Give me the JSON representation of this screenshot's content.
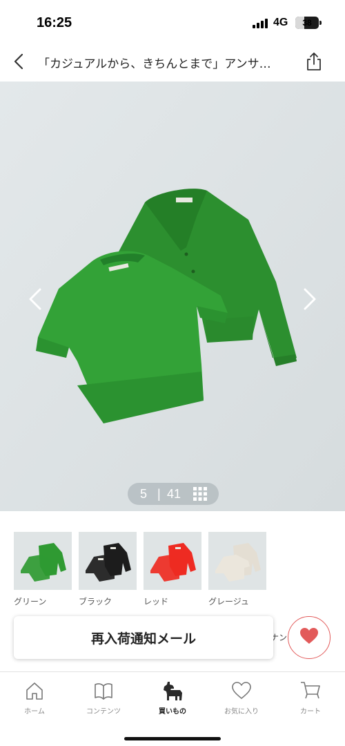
{
  "status_bar": {
    "time": "16:25",
    "network": "4G",
    "battery": "38",
    "battery_level": 0.38
  },
  "header": {
    "title": "「カジュアルから、きちんとまで」アンサ…",
    "back_icon": "chevron-left-icon",
    "share_icon": "share-icon"
  },
  "gallery": {
    "current": "5",
    "separator": "|",
    "total": "41",
    "background": "#dde3e5",
    "product_color": "#2f9a32"
  },
  "swatches": [
    {
      "label": "グリーン",
      "color": "#2f9a32"
    },
    {
      "label": "ブラック",
      "color": "#1c1c1c"
    },
    {
      "label": "レッド",
      "color": "#ee2b22"
    },
    {
      "label": "グレージュ",
      "color": "#e4ded3"
    }
  ],
  "actions": {
    "notify_label": "再入荷通知メール",
    "peek_text": "ナン",
    "accent": "#e25a5a"
  },
  "tabs": [
    {
      "label": "ホーム",
      "icon": "home-icon"
    },
    {
      "label": "コンテンツ",
      "icon": "book-icon"
    },
    {
      "label": "買いもの",
      "icon": "horse-icon",
      "active": true
    },
    {
      "label": "お気に入り",
      "icon": "heart-icon"
    },
    {
      "label": "カート",
      "icon": "cart-icon"
    }
  ]
}
